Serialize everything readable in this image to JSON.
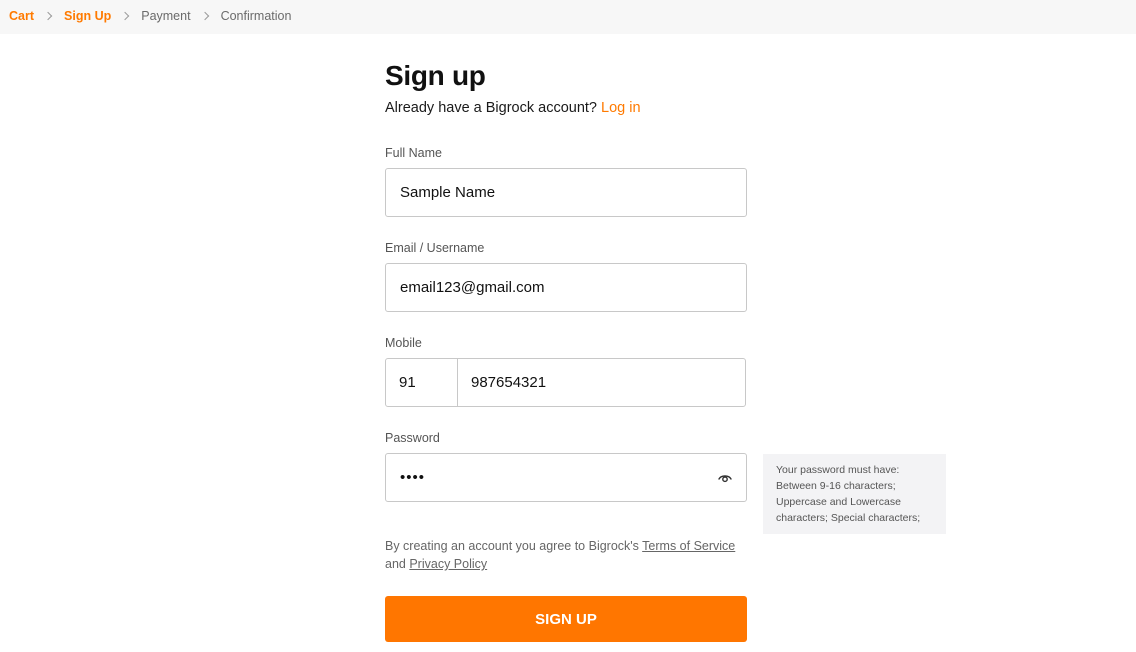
{
  "breadcrumb": {
    "items": [
      {
        "label": "Cart",
        "active": true
      },
      {
        "label": "Sign Up",
        "active": true
      },
      {
        "label": "Payment",
        "active": false
      },
      {
        "label": "Confirmation",
        "active": false
      }
    ]
  },
  "header": {
    "title": "Sign up",
    "subtitle": "Already have a Bigrock account?",
    "login_link": "Log in"
  },
  "form": {
    "full_name": {
      "label": "Full Name",
      "value": "Sample Name"
    },
    "email": {
      "label": "Email / Username",
      "value": "email123@gmail.com"
    },
    "mobile": {
      "label": "Mobile",
      "country_code": "91",
      "number": "987654321"
    },
    "password": {
      "label": "Password",
      "value": "••••",
      "toggle_icon": "eye-icon"
    },
    "password_hint": {
      "line1": "Your password must have:",
      "line2": "Between 9-16 characters;",
      "line3": "Uppercase and Lowercase",
      "line4": "characters; Special characters;"
    }
  },
  "terms": {
    "prefix": "By creating an account you agree to Bigrock's",
    "terms_link": "Terms of Service",
    "conjunction": "and",
    "privacy_link": "Privacy Policy"
  },
  "submit_label": "SIGN UP",
  "colors": {
    "accent": "#ff7600",
    "link": "#ff7a00"
  }
}
